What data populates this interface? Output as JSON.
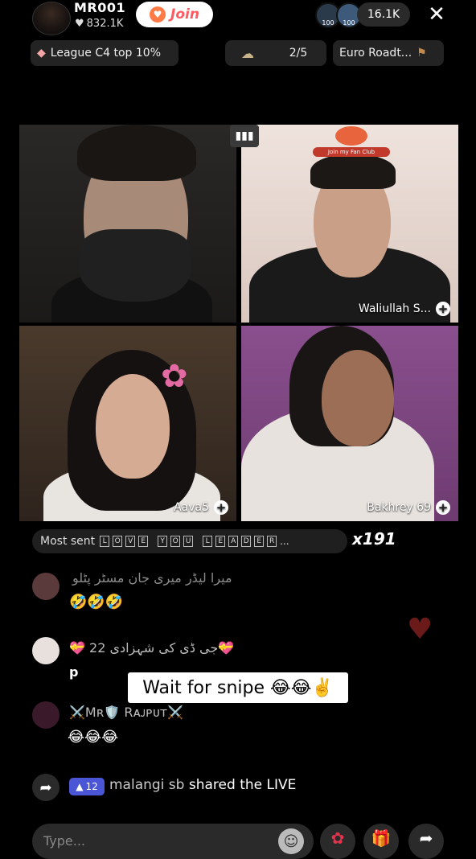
{
  "header": {
    "host_name": "MR001",
    "host_likes": "832.1K",
    "join_label": "Join",
    "viewer_badges": [
      "100",
      "100"
    ],
    "viewer_count": "16.1K",
    "close_glyph": "✕"
  },
  "pills": {
    "league": "League C4 top 10%",
    "progress": "2/5",
    "roadtrip": "Euro Roadt..."
  },
  "guests": [
    {
      "name": ""
    },
    {
      "name": "Waliullah S..."
    },
    {
      "name": "Aava5"
    },
    {
      "name": "Bakhrey 69"
    }
  ],
  "fan_club_label": "Join my Fan Club",
  "gift_bar": {
    "prefix": "Most sent",
    "letters": [
      "L",
      "O",
      "V",
      "E",
      "Y",
      "O",
      "U",
      "L",
      "E",
      "A",
      "D",
      "E",
      "R"
    ],
    "ellipsis": "...",
    "count": "x191"
  },
  "comments": [
    {
      "text": "میرا لیڈر میری جان مسٹر پٹلو",
      "sub": "🤣🤣🤣"
    },
    {
      "text": "💝جی ڈی کی شہزادی 22 💝",
      "sub": "p"
    },
    {
      "text": "⚔️Mʀ🛡️ Rᴀᴊᴘᴜᴛ⚔️",
      "sub": "😂😂😂"
    }
  ],
  "caption": "Wait for snipe 😂😂✌️",
  "share_event": {
    "level": "12",
    "user": "malangi sb",
    "action": "shared the LIVE"
  },
  "bottom": {
    "input_placeholder": "Type..."
  },
  "colors": {
    "background": "#000000",
    "join_text": "#ff5a5f",
    "level_badge": "#4a56d6",
    "pill_bg": "#232323"
  },
  "icons": [
    "verified-heart-icon",
    "diamond-icon",
    "coin-icon",
    "signpost-icon",
    "close-icon",
    "plus-icon",
    "share-icon",
    "emoji-icon",
    "rose-gift-icon",
    "gift-icon",
    "forward-icon"
  ]
}
